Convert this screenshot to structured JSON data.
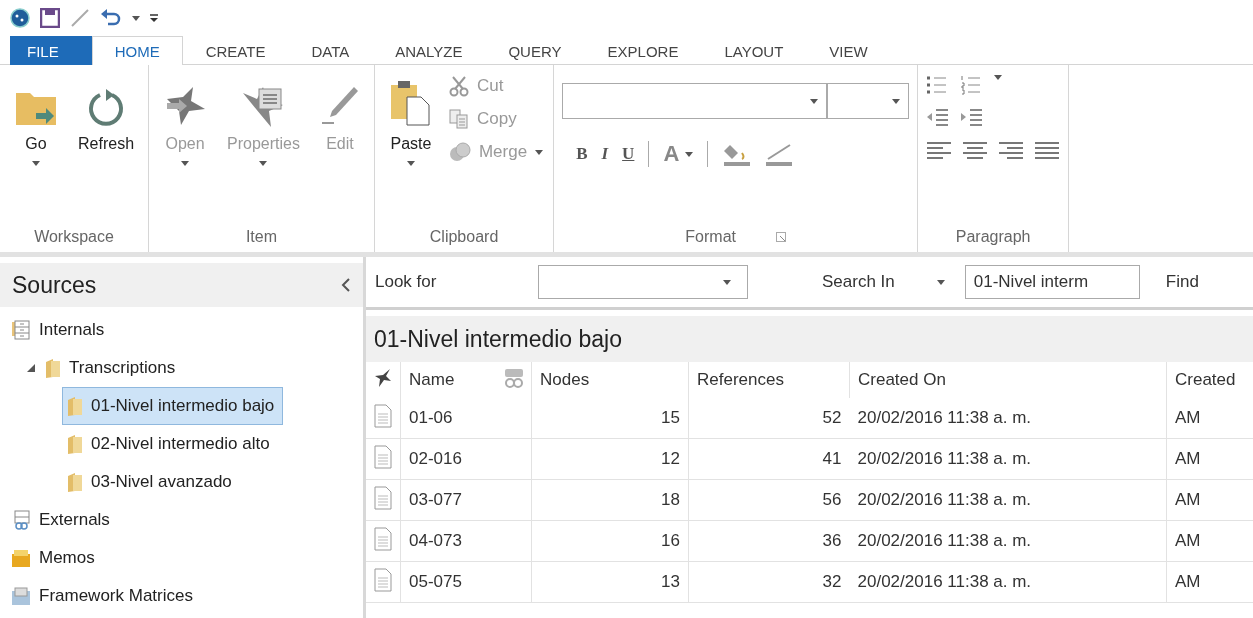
{
  "tabs": [
    {
      "label": "FILE",
      "kind": "file",
      "selected": false
    },
    {
      "label": "HOME",
      "kind": "tab",
      "selected": true
    },
    {
      "label": "CREATE",
      "kind": "tab",
      "selected": false
    },
    {
      "label": "DATA",
      "kind": "tab",
      "selected": false
    },
    {
      "label": "ANALYZE",
      "kind": "tab",
      "selected": false
    },
    {
      "label": "QUERY",
      "kind": "tab",
      "selected": false
    },
    {
      "label": "EXPLORE",
      "kind": "tab",
      "selected": false
    },
    {
      "label": "LAYOUT",
      "kind": "tab",
      "selected": false
    },
    {
      "label": "VIEW",
      "kind": "tab",
      "selected": false
    }
  ],
  "ribbon": [
    {
      "label": "Workspace",
      "kind": "buttons",
      "buttons": [
        {
          "label": "Go",
          "dropdown": true,
          "disabled": false
        },
        {
          "label": "Refresh",
          "dropdown": false,
          "disabled": false
        }
      ]
    },
    {
      "label": "Item",
      "kind": "buttons",
      "buttons": [
        {
          "label": "Open",
          "dropdown": true,
          "disabled": true
        },
        {
          "label": "Properties",
          "dropdown": true,
          "disabled": true
        },
        {
          "label": "Edit",
          "dropdown": false,
          "disabled": true
        }
      ]
    },
    {
      "label": "Clipboard",
      "kind": "clipboard",
      "buttons": [
        {
          "label": "Paste",
          "dropdown": true,
          "disabled": false
        }
      ],
      "small": [
        {
          "label": "Cut",
          "dropdown": false,
          "disabled": true
        },
        {
          "label": "Copy",
          "dropdown": false,
          "disabled": true
        },
        {
          "label": "Merge",
          "dropdown": true,
          "disabled": true
        }
      ]
    },
    {
      "label": "Format",
      "kind": "format",
      "styles": [
        "B",
        "I",
        "U"
      ],
      "color_letter": "A"
    },
    {
      "label": "Paragraph",
      "kind": "paragraph"
    }
  ],
  "sidebar": {
    "title": "Sources",
    "items": [
      {
        "label": "Internals",
        "selected": false,
        "children": [
          {
            "label": "Transcriptions",
            "selected": false,
            "expanded": true,
            "children": [
              {
                "label": "01-Nivel intermedio bajo",
                "selected": true
              },
              {
                "label": "02-Nivel intermedio alto",
                "selected": false
              },
              {
                "label": "03-Nivel avanzado",
                "selected": false
              }
            ]
          }
        ]
      },
      {
        "label": "Externals",
        "selected": false
      },
      {
        "label": "Memos",
        "selected": false
      },
      {
        "label": "Framework Matrices",
        "selected": false
      }
    ]
  },
  "search": {
    "look_for_label": "Look for",
    "search_in_label": "Search In",
    "search_in_value": "01-Nivel interm",
    "find_label": "Find"
  },
  "folder_title": "01-Nivel intermedio bajo",
  "table": {
    "columns": [
      "Name",
      "Nodes",
      "References",
      "Created On",
      "Created"
    ],
    "rows": [
      [
        "01-06",
        "15",
        "52",
        "20/02/2016 11:38 a. m.",
        "AM"
      ],
      [
        "02-016",
        "12",
        "41",
        "20/02/2016 11:38 a. m.",
        "AM"
      ],
      [
        "03-077",
        "18",
        "56",
        "20/02/2016 11:38 a. m.",
        "AM"
      ],
      [
        "04-073",
        "16",
        "36",
        "20/02/2016 11:38 a. m.",
        "AM"
      ],
      [
        "05-075",
        "13",
        "32",
        "20/02/2016 11:38 a. m.",
        "AM"
      ]
    ]
  }
}
